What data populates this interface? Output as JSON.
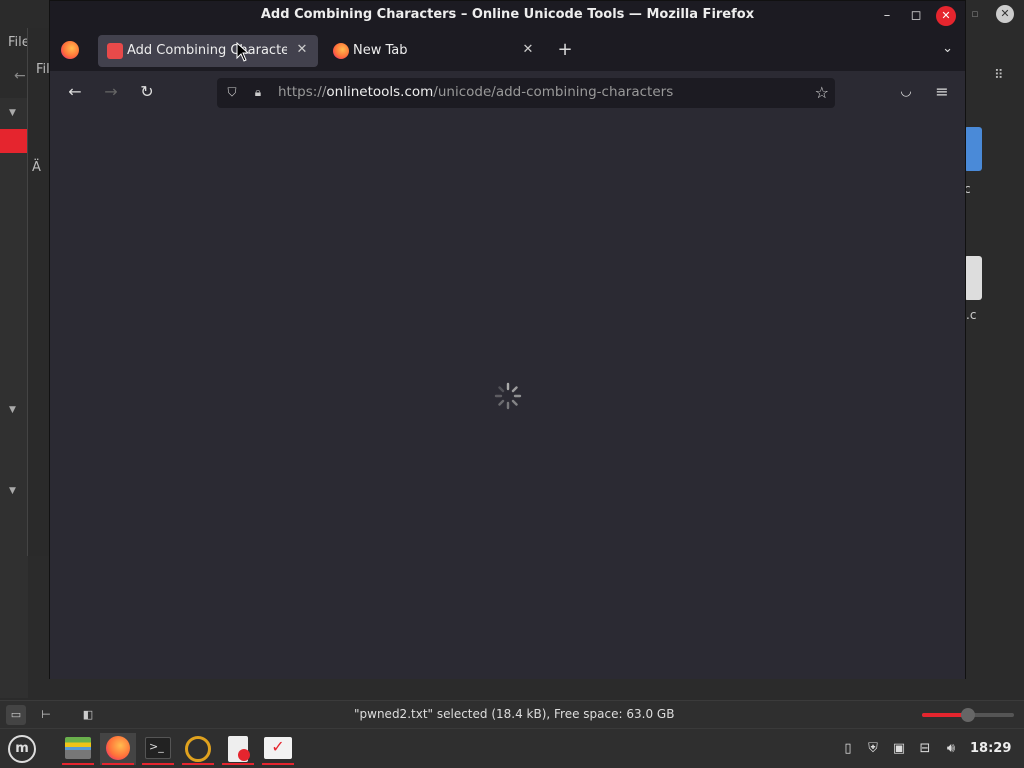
{
  "background_app": {
    "menu_file": "File",
    "inner_menu": "Fil",
    "accent_char": "Ä",
    "desktop_label_1": "c",
    "desktop_label_2": "ell.c"
  },
  "firefox": {
    "window_title": "Add Combining Characters – Online Unicode Tools — Mozilla Firefox",
    "tabs": [
      {
        "label": "Add Combining Characters",
        "active": true,
        "icon": "onlinetools-icon"
      },
      {
        "label": "New Tab",
        "active": false,
        "icon": "firefox-icon"
      }
    ],
    "url": {
      "scheme": "https://",
      "host": "onlinetools.com",
      "path": "/unicode/add-combining-characters"
    },
    "page_state": "loading"
  },
  "statusbar": {
    "text": "\"pwned2.txt\" selected (18.4 kB), Free space: 63.0 GB",
    "zoom_fraction": 0.5
  },
  "taskbar": {
    "clock": "18:29",
    "apps": [
      "menu-icon",
      "files-icon",
      "firefox-icon",
      "terminal-icon",
      "sync-icon",
      "text-editor-icon",
      "todo-icon"
    ]
  },
  "colors": {
    "accent": "#e5252e",
    "ff_frame": "#1c1b22",
    "ff_content": "#2b2a33"
  }
}
